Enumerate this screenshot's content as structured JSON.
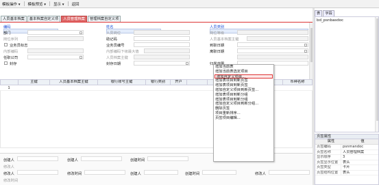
{
  "toolbar": {
    "items": [
      "模板操作 ▾",
      "模板预览 ▾",
      "显示 ▾",
      "返回"
    ]
  },
  "tabs": [
    "人员基本档案",
    "基本档案自定义项",
    "人员管理档案",
    "管理档案自定义项"
  ],
  "active_tab_index": 2,
  "form": {
    "col1": [
      {
        "label": "编码",
        "style": "req"
      },
      {
        "label": "部门",
        "style": "normal"
      },
      {
        "label": "岗位序列",
        "style": "grey"
      },
      {
        "label": "业务员标志",
        "style": "check"
      },
      {
        "label": "内部编码",
        "style": "grey"
      },
      {
        "label": "任职公司",
        "style": "normal"
      },
      {
        "label": "封存",
        "style": "check"
      }
    ],
    "col2": [
      {
        "label": "姓名",
        "style": "req"
      },
      {
        "label": "人员岗位",
        "style": "grey"
      },
      {
        "label": "助记码",
        "style": "normal"
      },
      {
        "label": "业务员编号",
        "style": "normal"
      },
      {
        "label": "内部编码下级最大值",
        "style": "grey"
      },
      {
        "label": "人员档案主键",
        "style": "grey"
      },
      {
        "label": "封存日期",
        "style": "normal"
      }
    ],
    "col3": [
      {
        "label": "人员类别",
        "style": "req"
      },
      {
        "label": "岗位等级",
        "style": "grey"
      },
      {
        "label": "人员基本档案主键",
        "style": "grey"
      },
      {
        "label": "到职日期",
        "style": "normal"
      },
      {
        "label": "离职日期",
        "style": "normal"
      },
      {
        "label": "",
        "style": "grey"
      },
      {
        "label": "归属范围",
        "style": "normal"
      }
    ]
  },
  "grid": {
    "columns": [
      "",
      "主键",
      "人员基本档案主键",
      "银行账号主键",
      "银行类别",
      "开户",
      "",
      "",
      "",
      "账号",
      "币种名称"
    ],
    "rows": [
      {
        "num": "1"
      }
    ]
  },
  "context_menu": {
    "items": [
      "增加当前表",
      "增加当前表选定项目",
      "增加自定义项目...",
      "增加表项目到新页签",
      "增加表项目到新页签",
      "增加自定义项目到新页签...",
      "增加表项目到新分组",
      "增加表项目到新分组",
      "增加自定义项目到新分组...",
      "删除页签",
      "项目重新排序...",
      "页签项目编辑..."
    ],
    "highlighted_index": 2
  },
  "bottom_panel": {
    "row1": [
      "创建人",
      "创建人",
      "创建时间"
    ],
    "row2": [
      "修改人"
    ],
    "row3": [
      "修改人",
      "修改时间",
      "创建人",
      "创建时间",
      "修改人"
    ],
    "row4": [
      "修改时间"
    ]
  },
  "right_panel": {
    "tabs": [
      "表",
      "字段"
    ],
    "items": [
      "bd_psnbasdoc"
    ]
  },
  "properties": {
    "title": "页签属性",
    "header": [
      "属性",
      "值"
    ],
    "rows": [
      {
        "key": "页签编码",
        "value": "psnmandoc"
      },
      {
        "key": "页签名称",
        "value": "人员管理档案"
      },
      {
        "key": "显示顺序",
        "value": "3"
      },
      {
        "key": "页签显示位置",
        "value": "表头"
      },
      {
        "key": "页签类型",
        "value": "卡片"
      },
      {
        "key": "页签结构位置",
        "value": "表头"
      }
    ]
  }
}
